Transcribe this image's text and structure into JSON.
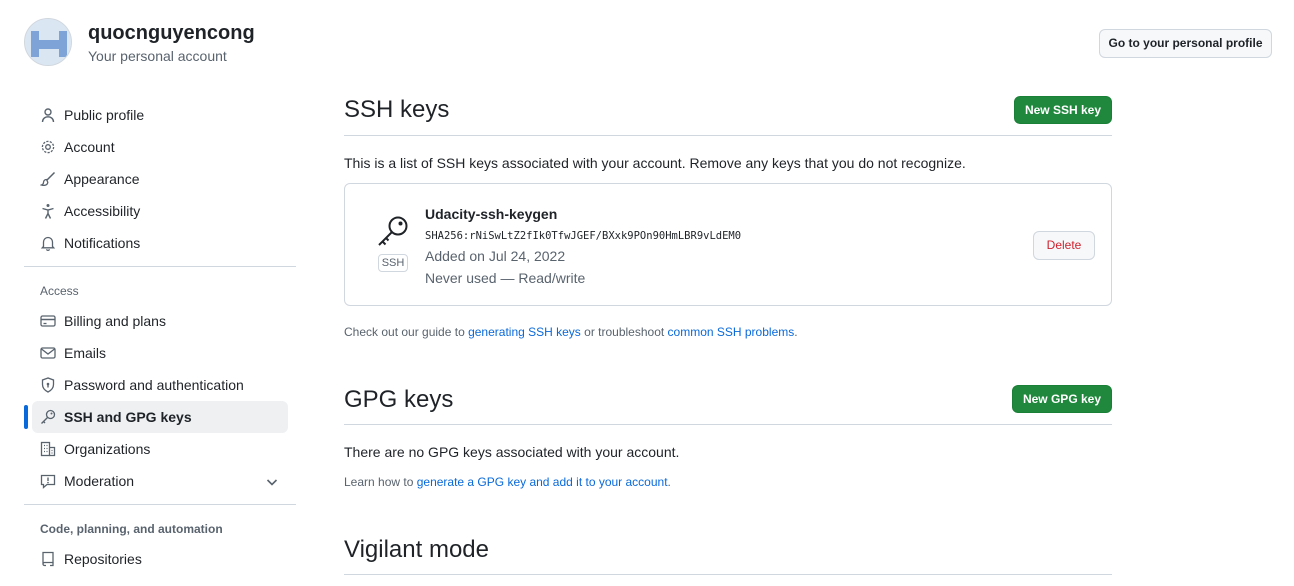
{
  "header": {
    "username": "quocnguyencong",
    "subtitle": "Your personal account",
    "profile_button": "Go to your personal profile"
  },
  "sidebar": {
    "top_items": [
      {
        "label": "Public profile",
        "icon": "person-icon"
      },
      {
        "label": "Account",
        "icon": "gear-icon"
      },
      {
        "label": "Appearance",
        "icon": "paintbrush-icon"
      },
      {
        "label": "Accessibility",
        "icon": "accessibility-icon"
      },
      {
        "label": "Notifications",
        "icon": "bell-icon"
      }
    ],
    "access_heading": "Access",
    "access_items": [
      {
        "label": "Billing and plans",
        "icon": "credit-card-icon"
      },
      {
        "label": "Emails",
        "icon": "mail-icon"
      },
      {
        "label": "Password and authentication",
        "icon": "shield-lock-icon"
      },
      {
        "label": "SSH and GPG keys",
        "icon": "key-icon",
        "active": true
      },
      {
        "label": "Organizations",
        "icon": "organization-icon"
      },
      {
        "label": "Moderation",
        "icon": "report-icon"
      }
    ],
    "code_heading": "Code, planning, and automation",
    "code_items": [
      {
        "label": "Repositories",
        "icon": "repo-icon"
      }
    ]
  },
  "ssh": {
    "title": "SSH keys",
    "new_button": "New SSH key",
    "description": "This is a list of SSH keys associated with your account. Remove any keys that you do not recognize.",
    "key": {
      "name": "Udacity-ssh-keygen",
      "fingerprint": "SHA256:rNiSwLtZ2fIk0TfwJGEF/BXxk9POn90HmLBR9vLdEM0",
      "added": "Added on Jul 24, 2022",
      "usage": "Never used — Read/write",
      "badge": "SSH",
      "delete_button": "Delete"
    },
    "guide_prefix": "Check out our guide to ",
    "guide_link1": "generating SSH keys",
    "guide_middle": " or troubleshoot ",
    "guide_link2": "common SSH problems",
    "guide_suffix": "."
  },
  "gpg": {
    "title": "GPG keys",
    "new_button": "New GPG key",
    "empty_text": "There are no GPG keys associated with your account.",
    "learn_prefix": "Learn how to ",
    "learn_link": "generate a GPG key and add it to your account",
    "learn_suffix": "."
  },
  "vigilant": {
    "title": "Vigilant mode"
  },
  "colors": {
    "primary": "#1f883d",
    "link": "#0969da",
    "danger": "#cf222e",
    "active_indicator": "#0969da"
  }
}
